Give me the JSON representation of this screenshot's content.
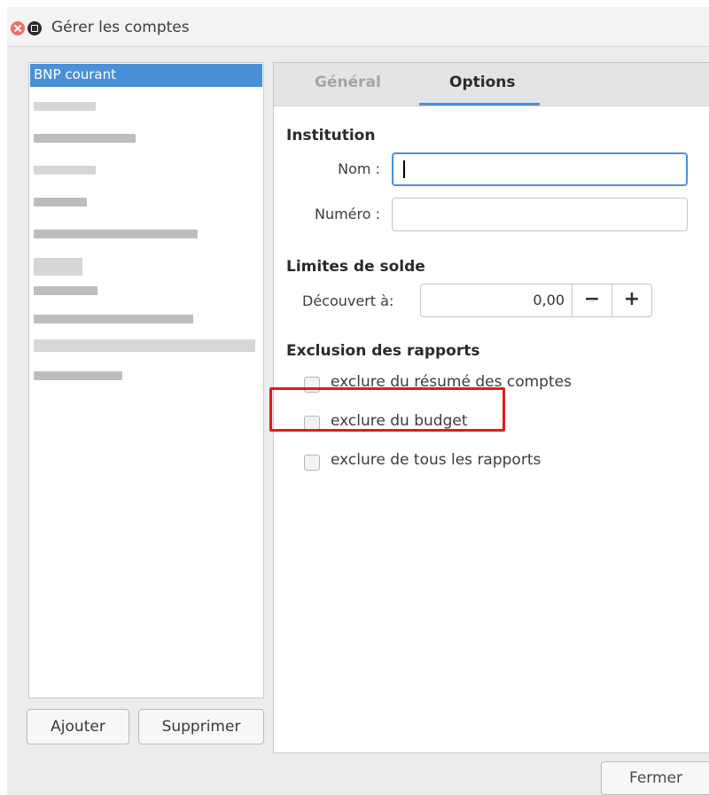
{
  "window": {
    "title": "Gérer les comptes"
  },
  "accounts": {
    "items": [
      {
        "label": "BNP courant",
        "selected": true
      }
    ]
  },
  "left_buttons": {
    "add": "Ajouter",
    "remove": "Supprimer"
  },
  "tabs": [
    {
      "label": "Général",
      "active": false
    },
    {
      "label": "Options",
      "active": true
    }
  ],
  "institution": {
    "title": "Institution",
    "name_label": "Nom :",
    "name_value": "",
    "number_label": "Numéro :",
    "number_value": ""
  },
  "balance_limits": {
    "title": "Limites de solde",
    "overdraft_label": "Découvert à:",
    "overdraft_value": "0,00",
    "decrement": "−",
    "increment": "+"
  },
  "report_exclusion": {
    "title": "Exclusion des rapports",
    "options": [
      {
        "label": "exclure du résumé des comptes",
        "checked": false
      },
      {
        "label": "exclure du budget",
        "checked": false,
        "highlighted": true
      },
      {
        "label": "exclure de tous les rapports",
        "checked": false
      }
    ]
  },
  "footer": {
    "close": "Fermer"
  },
  "colors": {
    "accent": "#4a90d9",
    "highlight": "#e11b1b"
  }
}
